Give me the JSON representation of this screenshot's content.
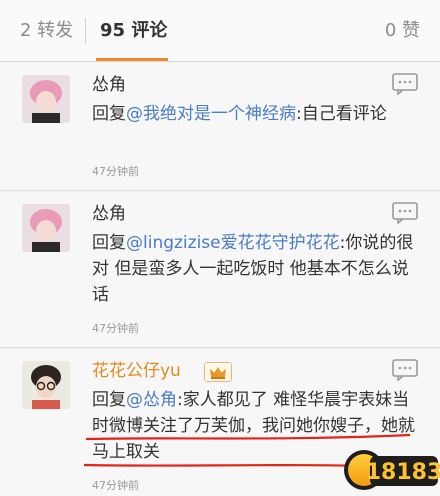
{
  "tabs": {
    "repost": "2 转发",
    "comment_count": "95",
    "comment_label": "评论",
    "like": "0 赞"
  },
  "comments": [
    {
      "user": "怂角",
      "reply_prefix": "回复",
      "mention": "@我绝对是一个神经病",
      "text": ":自己看评论",
      "time": "47分钟前"
    },
    {
      "user": "怂角",
      "reply_prefix": "回复",
      "mention": "@lingzizise爱花花守护花花",
      "text": ":你说的很对 但是蛮多人一起吃饭时 他基本不怎么说话",
      "time": "47分钟前"
    },
    {
      "user": "花花公仔yu",
      "reply_prefix": "回复",
      "mention": "@怂角",
      "text": ":家人都见了 难怪华晨宇表妹当时微博关注了万芙伽，我问她你嫂子，她就马上取关",
      "time": "47分钟前"
    }
  ],
  "watermark": "18183",
  "colors": {
    "accent": "#f08a2a",
    "mention": "#4a7cc7",
    "vip_name": "#e28a1d"
  }
}
